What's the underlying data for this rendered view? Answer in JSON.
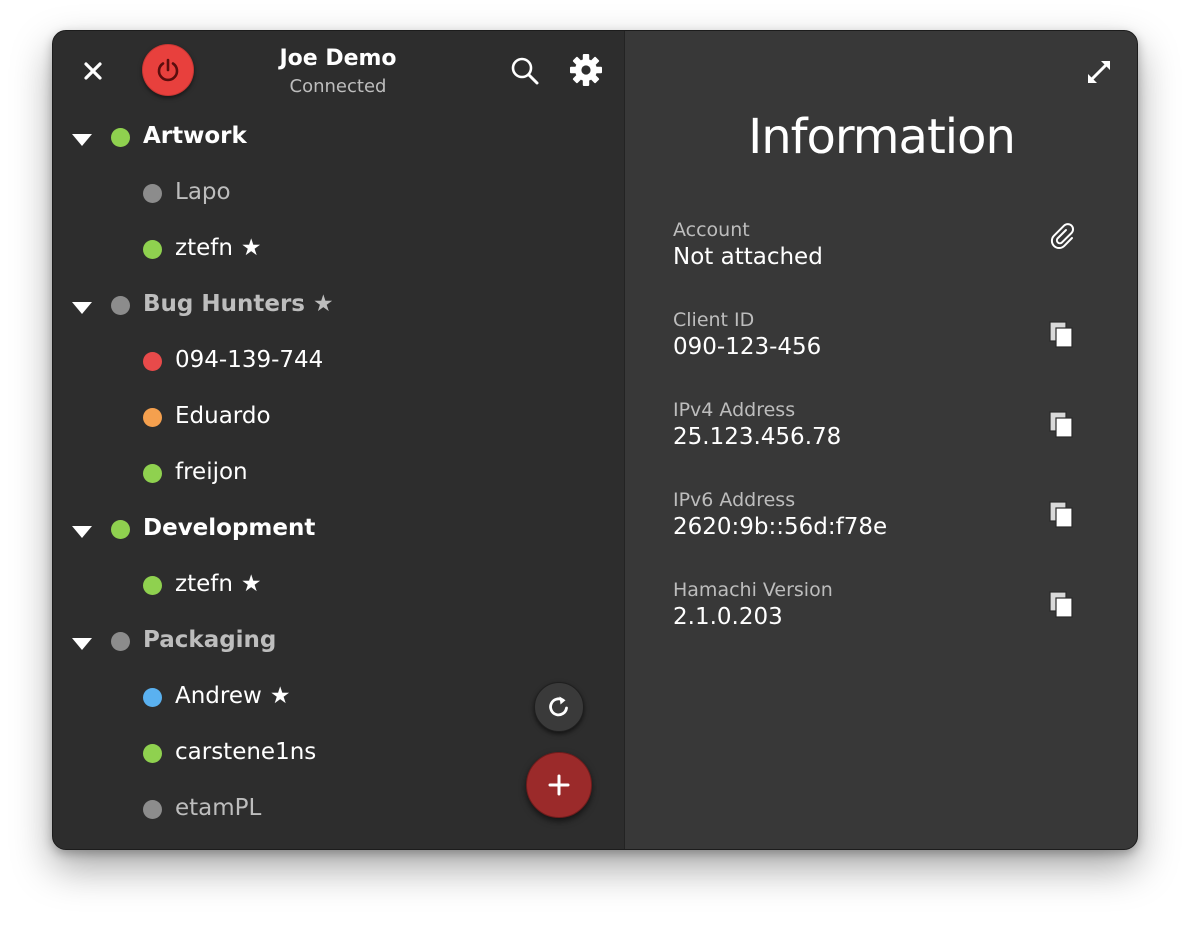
{
  "header": {
    "user_name": "Joe Demo",
    "status": "Connected"
  },
  "colors": {
    "online": "#8fd14f",
    "offline": "#8c8c8c",
    "error": "#e84a4a",
    "warning": "#f5a04e",
    "relayed": "#5ab1f0",
    "power": "#e8403d",
    "add": "#9b2a2a"
  },
  "networks": [
    {
      "name": "Artwork",
      "starred": false,
      "status": "online",
      "bold_white": true,
      "peers": [
        {
          "name": "Lapo",
          "status": "offline",
          "starred": false
        },
        {
          "name": "ztefn",
          "status": "online",
          "starred": true
        }
      ]
    },
    {
      "name": "Bug Hunters",
      "starred": true,
      "status": "offline",
      "bold_white": false,
      "peers": [
        {
          "name": "094-139-744",
          "status": "error",
          "starred": false
        },
        {
          "name": "Eduardo",
          "status": "warning",
          "starred": false
        },
        {
          "name": "freijon",
          "status": "online",
          "starred": false
        }
      ]
    },
    {
      "name": "Development",
      "starred": false,
      "status": "online",
      "bold_white": true,
      "peers": [
        {
          "name": "ztefn",
          "status": "online",
          "starred": true
        }
      ]
    },
    {
      "name": "Packaging",
      "starred": false,
      "status": "offline",
      "bold_white": false,
      "peers": [
        {
          "name": "Andrew",
          "status": "relayed",
          "starred": true
        },
        {
          "name": "carstene1ns",
          "status": "online",
          "starred": false
        },
        {
          "name": "etamPL",
          "status": "offline",
          "starred": false
        }
      ]
    }
  ],
  "star_glyph": "★",
  "icons": {
    "close": "close-icon",
    "power": "power-icon",
    "search": "search-icon",
    "settings": "gear-icon",
    "expand": "expand-icon",
    "refresh": "refresh-icon",
    "add": "plus-icon",
    "attach": "paperclip-icon",
    "copy": "copy-icon"
  },
  "info": {
    "title": "Information",
    "fields": [
      {
        "label": "Account",
        "value": "Not attached",
        "action": "attach"
      },
      {
        "label": "Client ID",
        "value": "090-123-456",
        "action": "copy"
      },
      {
        "label": "IPv4 Address",
        "value": "25.123.456.78",
        "action": "copy"
      },
      {
        "label": "IPv6 Address",
        "value": "2620:9b::56d:f78e",
        "action": "copy"
      },
      {
        "label": "Hamachi Version",
        "value": "2.1.0.203",
        "action": "copy"
      }
    ]
  }
}
